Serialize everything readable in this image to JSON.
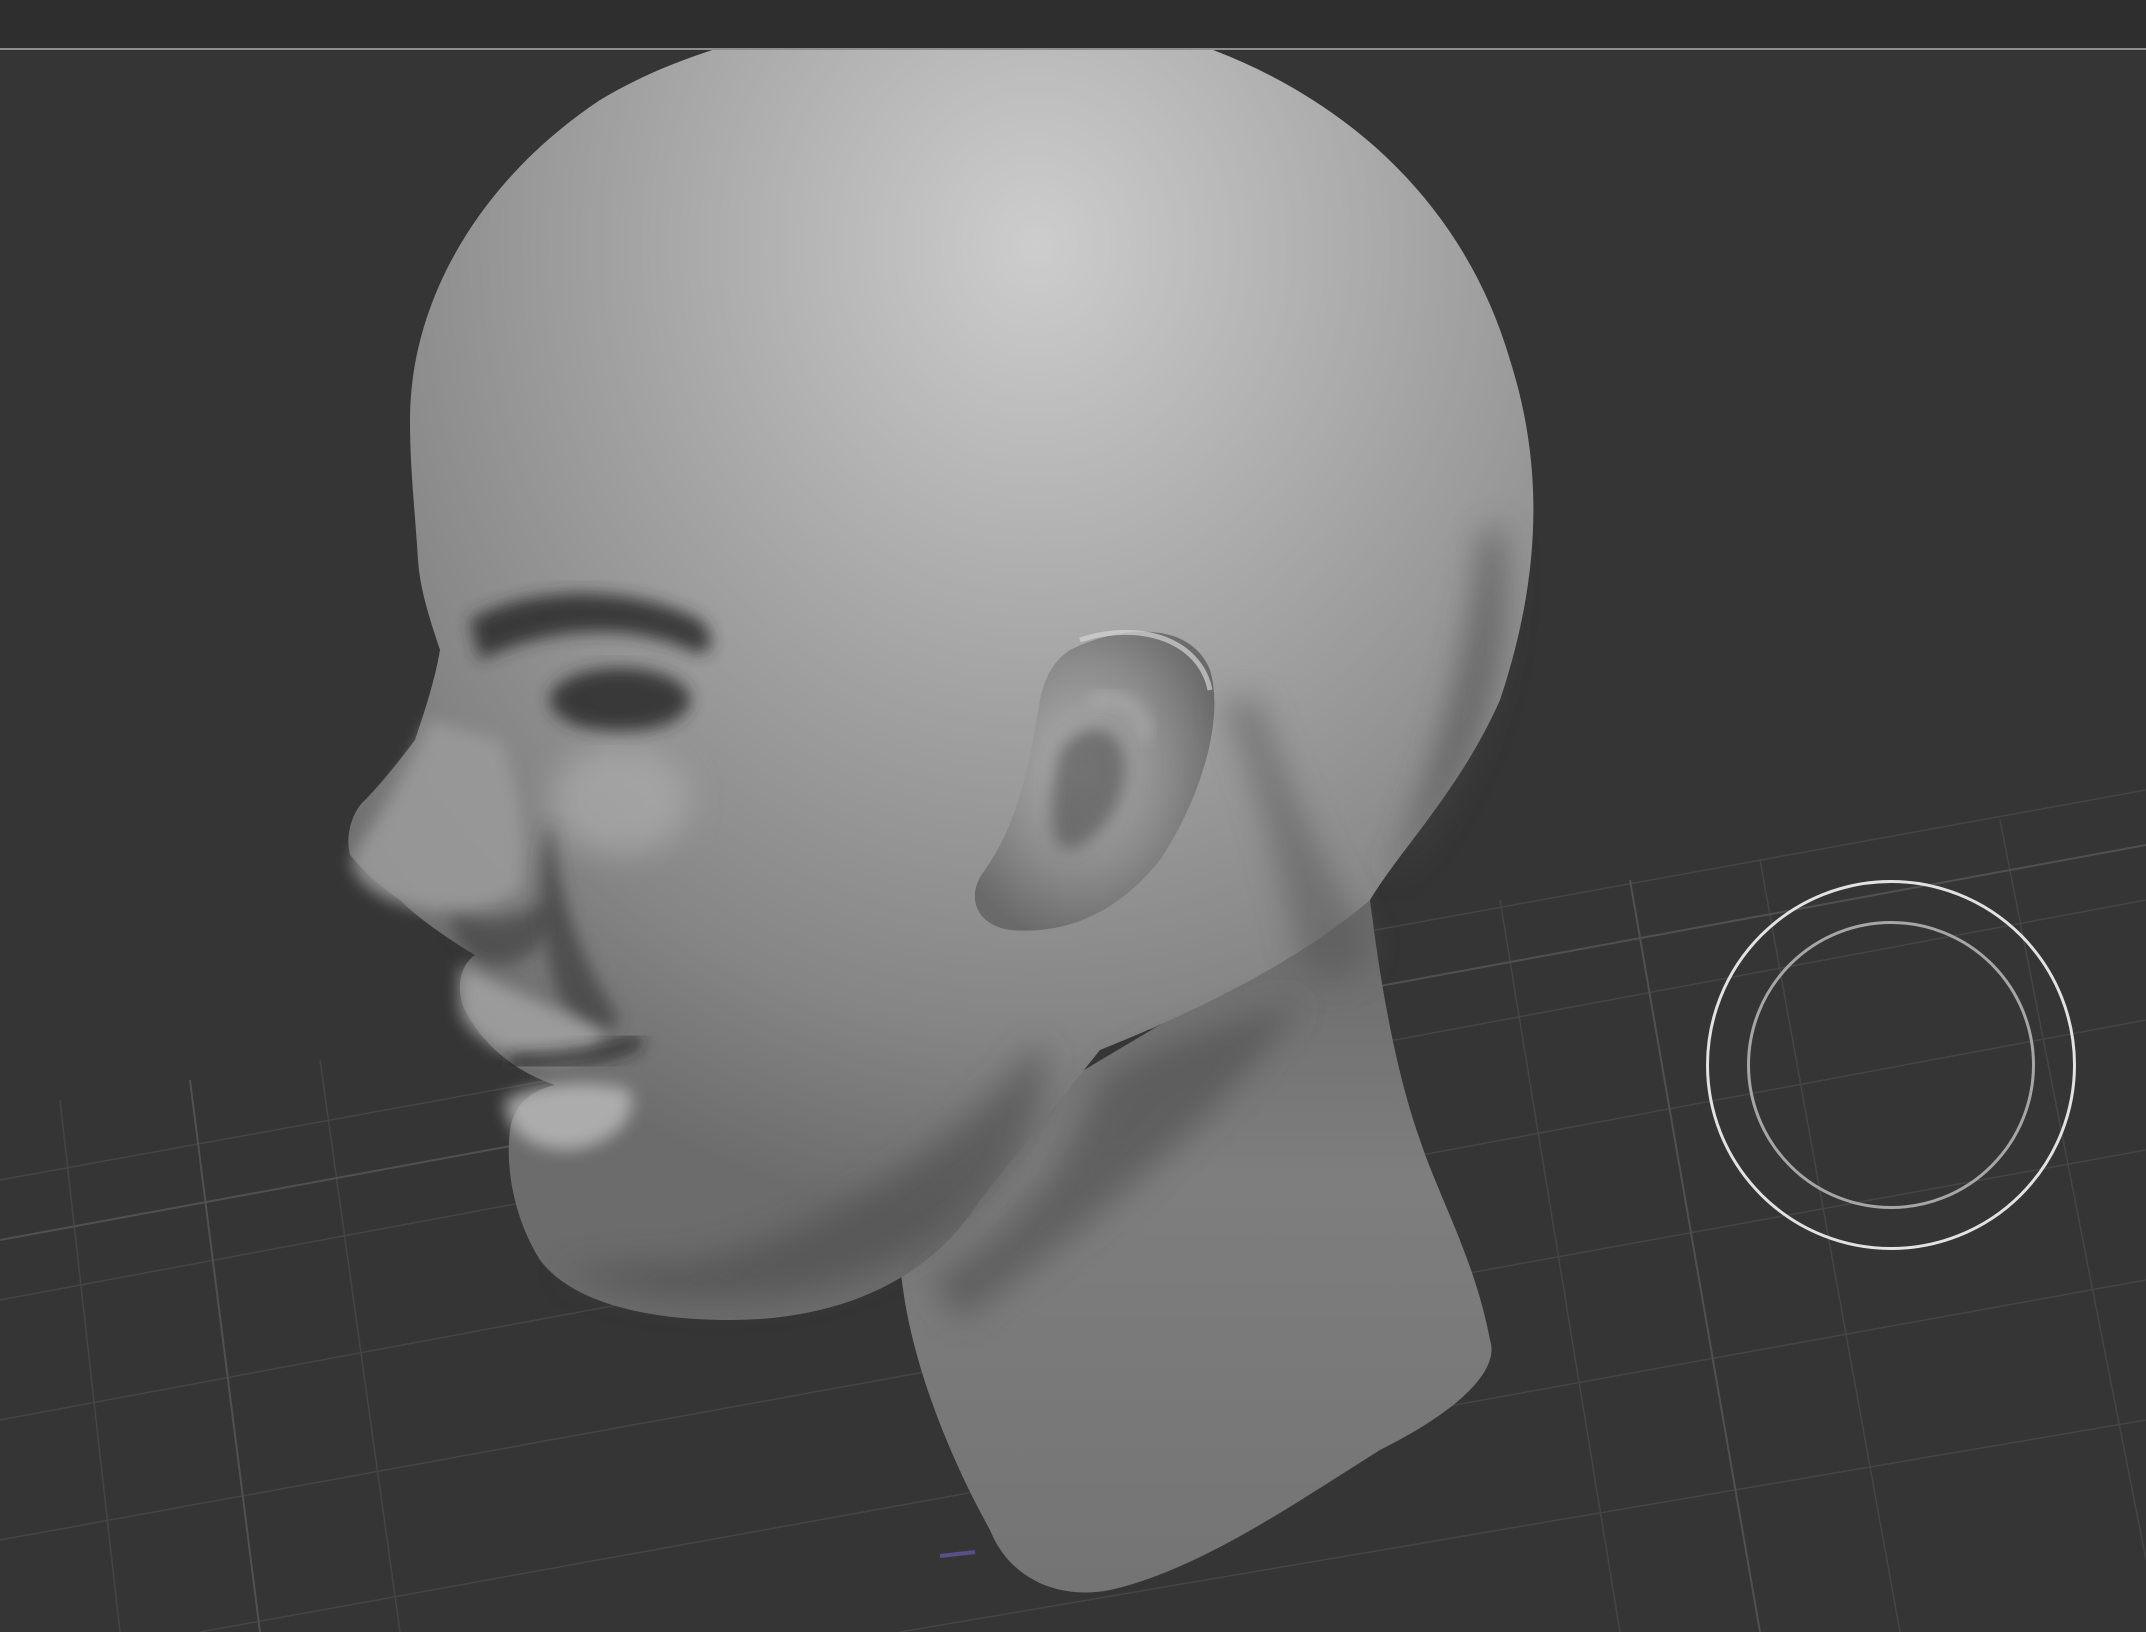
{
  "app": {
    "viewport_label": "",
    "background_color": "#353535",
    "grid_color": "#484848"
  },
  "model": {
    "name": "",
    "shading_color": "#8c8c8c"
  },
  "cursor": {
    "icon": "brush-circle-icon"
  }
}
